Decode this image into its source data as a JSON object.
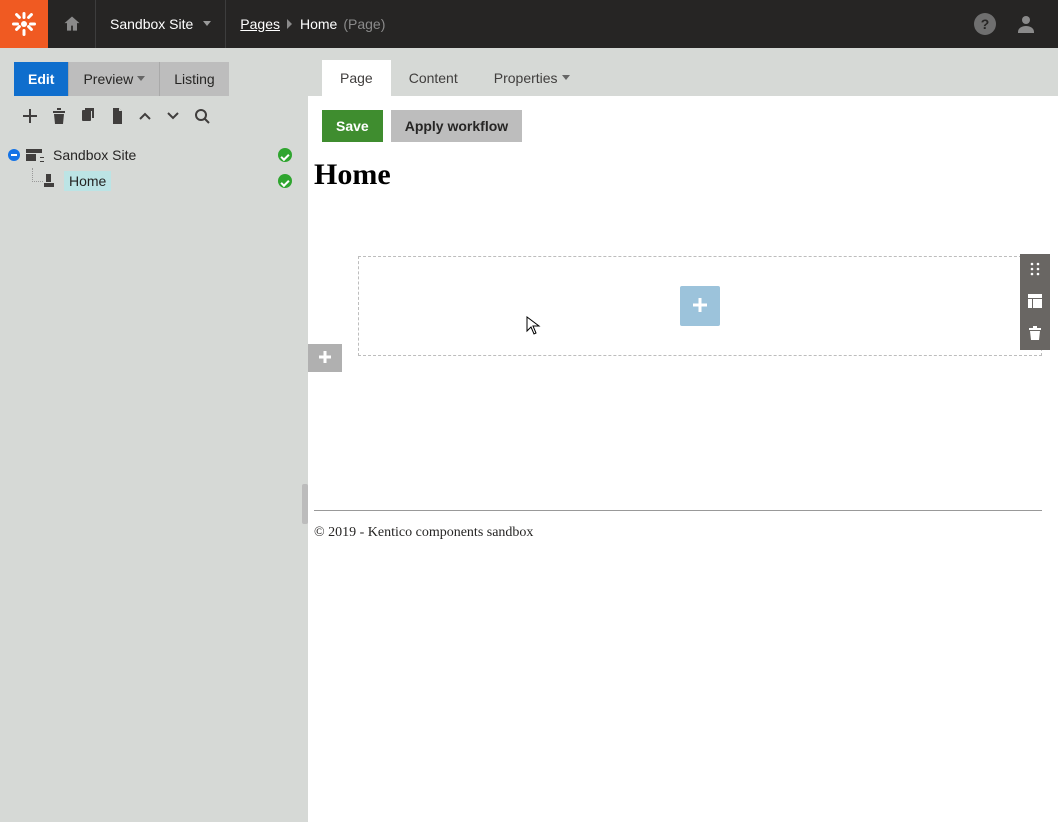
{
  "topbar": {
    "site_name": "Sandbox Site",
    "breadcrumb": {
      "root": "Pages",
      "current": "Home",
      "type": "(Page)"
    }
  },
  "modes": {
    "edit": "Edit",
    "preview": "Preview",
    "listing": "Listing"
  },
  "tree": {
    "root_label": "Sandbox Site",
    "child_label": "Home"
  },
  "contentTabs": {
    "page": "Page",
    "content": "Content",
    "properties": "Properties"
  },
  "editor": {
    "save_label": "Save",
    "workflow_label": "Apply workflow",
    "heading": "Home",
    "footer": "© 2019 - Kentico components sandbox"
  }
}
